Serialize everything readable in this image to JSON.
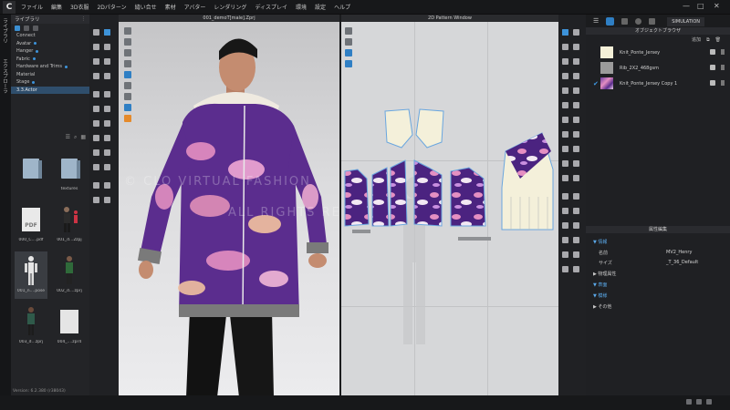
{
  "menubar": {
    "logo": "C",
    "items": [
      "ファイル",
      "編集",
      "3D衣服",
      "2Dパターン",
      "縫い合せ",
      "素材",
      "アバター",
      "レンダリング",
      "ディスプレイ",
      "環境",
      "設定",
      "ヘルプ"
    ],
    "window_controls": [
      "—",
      "□",
      "✕"
    ]
  },
  "vertical_tabs": [
    "ライブラリ",
    "エクスプローラ"
  ],
  "library": {
    "title": "ライブラリ",
    "tree": [
      {
        "label": "Connect",
        "dot": false
      },
      {
        "label": "Avatar",
        "dot": true
      },
      {
        "label": "Hanger",
        "dot": true
      },
      {
        "label": "Fabric",
        "dot": true
      },
      {
        "label": "Hardware and Trims",
        "dot": true
      },
      {
        "label": "Material",
        "dot": false
      },
      {
        "label": "Stage",
        "dot": true
      },
      {
        "label": "3.3.Actor",
        "dot": false
      }
    ],
    "thumbnails": [
      {
        "label": "",
        "kind": "folder"
      },
      {
        "label": "textures",
        "kind": "folder"
      },
      {
        "label": "000_C....pdf",
        "kind": "pdf"
      },
      {
        "label": "001_d...2zpj",
        "kind": "avatar"
      },
      {
        "label": "001_n....pose",
        "kind": "figure"
      },
      {
        "label": "002_d....zprj",
        "kind": "avatar"
      },
      {
        "label": "003_d...zprj",
        "kind": "avatar"
      },
      {
        "label": "004_....zpr4",
        "kind": "doc"
      }
    ],
    "pdf_text": "PDF",
    "version": "Version: 6.2.380 (r38043)"
  },
  "viewport3d": {
    "title": "001_demoT[male].Zprj",
    "watermark_line1": "© CLO VIRTUAL FASHION",
    "watermark_line2": "ALL RIGHTS RESERVED."
  },
  "viewport2d": {
    "title": "2D Pattern Window"
  },
  "right_panel": {
    "simulation_label": "SIMULATION",
    "object_browser_title": "オブジェクトブラウザ",
    "add_label": "追加",
    "fabrics": [
      {
        "name": "Knit_Ponte_Jersey",
        "color": "#f4f0d8",
        "checked": false
      },
      {
        "name": "Rib_2X2_468gsm",
        "color": "#9b9b9b",
        "checked": false
      },
      {
        "name": "Knit_Ponte_Jersey Copy 1",
        "color": "#6a3da0",
        "checked": true
      }
    ],
    "property_title": "属性編集",
    "sections": {
      "info": "▼ 情報",
      "physical": "▶ 物理属性",
      "surface": "▼ 表面",
      "texture": "▼ 模様",
      "other": "▶ その他"
    },
    "props": [
      {
        "key": "名前",
        "value": "MV2_Henry"
      },
      {
        "key": "サイズ",
        "value": "_T_36_Default"
      }
    ]
  },
  "colors": {
    "accent": "#3d93da",
    "fabric_purple": "#5b2d8e",
    "fabric_pink": "#e58fc2",
    "fabric_cream": "#f3ecd2"
  }
}
